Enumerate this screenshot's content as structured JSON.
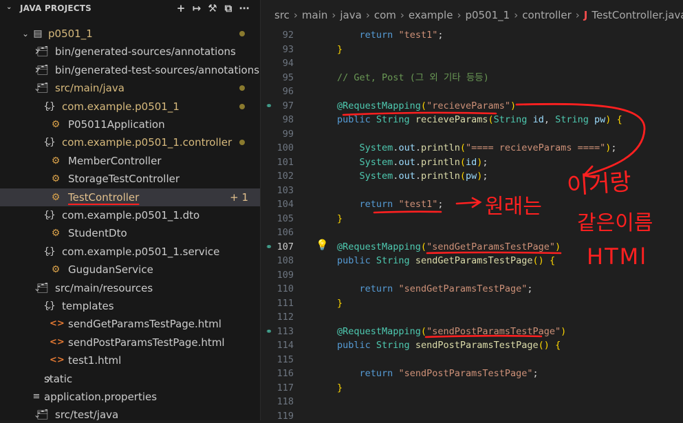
{
  "sidebar": {
    "title": "JAVA PROJECTS",
    "actions": [
      "add-icon",
      "link-icon",
      "tools-icon",
      "collapse-icon",
      "more-icon"
    ],
    "items": [
      {
        "label": "p0501_1",
        "depth": 1,
        "twisty": "open",
        "icon": "project-icon",
        "color": "yellow",
        "dot": true
      },
      {
        "label": "bin/generated-sources/annotations",
        "depth": 2,
        "twisty": "closed",
        "icon": "folder-icon"
      },
      {
        "label": "bin/generated-test-sources/annotations",
        "depth": 2,
        "twisty": "closed",
        "icon": "folder-icon"
      },
      {
        "label": "src/main/java",
        "depth": 2,
        "twisty": "open",
        "icon": "folder-icon",
        "color": "yellow",
        "dot": true
      },
      {
        "label": "com.example.p0501_1",
        "depth": 3,
        "twisty": "open",
        "icon": "package-icon",
        "color": "yellow",
        "dot": true
      },
      {
        "label": "P05011Application",
        "depth": 4,
        "icon": "class-icon"
      },
      {
        "label": "com.example.p0501_1.controller",
        "depth": 3,
        "twisty": "open",
        "icon": "package-icon",
        "color": "yellow",
        "dot": true
      },
      {
        "label": "MemberController",
        "depth": 4,
        "icon": "class-icon"
      },
      {
        "label": "StorageTestController",
        "depth": 4,
        "icon": "class-icon"
      },
      {
        "label": "TestController",
        "depth": 4,
        "icon": "class-icon",
        "color": "orange",
        "selected": true,
        "badge": "1"
      },
      {
        "label": "com.example.p0501_1.dto",
        "depth": 3,
        "twisty": "open",
        "icon": "package-icon"
      },
      {
        "label": "StudentDto",
        "depth": 4,
        "icon": "class-icon"
      },
      {
        "label": "com.example.p0501_1.service",
        "depth": 3,
        "twisty": "open",
        "icon": "package-icon"
      },
      {
        "label": "GugudanService",
        "depth": 4,
        "icon": "class-icon"
      },
      {
        "label": "src/main/resources",
        "depth": 2,
        "twisty": "open",
        "icon": "folder-icon"
      },
      {
        "label": "templates",
        "depth": 3,
        "twisty": "open",
        "icon": "package-icon"
      },
      {
        "label": "sendGetParamsTestPage.html",
        "depth": 4,
        "icon": "html-icon"
      },
      {
        "label": "sendPostParamsTestPage.html",
        "depth": 4,
        "icon": "html-icon"
      },
      {
        "label": "test1.html",
        "depth": 4,
        "icon": "html-icon"
      },
      {
        "label": "static",
        "depth": 3,
        "twisty": "closed"
      },
      {
        "label": "application.properties",
        "depth": 3,
        "icon": "properties-icon"
      },
      {
        "label": "src/test/java",
        "depth": 2,
        "twisty": "open",
        "icon": "folder-icon"
      }
    ]
  },
  "breadcrumb": [
    "src",
    "main",
    "java",
    "com",
    "example",
    "p0501_1",
    "controller",
    "TestController.java"
  ],
  "editor": {
    "lines": [
      {
        "n": "92",
        "text": "        return \"test1\";"
      },
      {
        "n": "93",
        "text": "    }"
      },
      {
        "n": "94",
        "text": ""
      },
      {
        "n": "95",
        "text": "    // Get, Post (그 외 기타 등등)"
      },
      {
        "n": "96",
        "text": ""
      },
      {
        "n": "97",
        "text": "    @RequestMapping(\"recieveParams\")",
        "gutter": "link"
      },
      {
        "n": "98",
        "text": "    public String recieveParams(String id, String pw) {"
      },
      {
        "n": "99",
        "text": ""
      },
      {
        "n": "100",
        "text": "        System.out.println(\"==== recieveParams ====\");"
      },
      {
        "n": "101",
        "text": "        System.out.println(id);"
      },
      {
        "n": "102",
        "text": "        System.out.println(pw);"
      },
      {
        "n": "103",
        "text": ""
      },
      {
        "n": "104",
        "text": "        return \"test1\";"
      },
      {
        "n": "105",
        "text": "    }"
      },
      {
        "n": "106",
        "text": ""
      },
      {
        "n": "107",
        "text": "    @RequestMapping(\"sendGetParamsTestPage\")",
        "gutter": "link",
        "active": true
      },
      {
        "n": "108",
        "text": "    public String sendGetParamsTestPage() {"
      },
      {
        "n": "109",
        "text": ""
      },
      {
        "n": "110",
        "text": "        return \"sendGetParamsTestPage\";"
      },
      {
        "n": "111",
        "text": "    }"
      },
      {
        "n": "112",
        "text": ""
      },
      {
        "n": "113",
        "text": "    @RequestMapping(\"sendPostParamsTestPage\")",
        "gutter": "link"
      },
      {
        "n": "114",
        "text": "    public String sendPostParamsTestPage() {"
      },
      {
        "n": "115",
        "text": ""
      },
      {
        "n": "116",
        "text": "        return \"sendPostParamsTestPage\";"
      },
      {
        "n": "117",
        "text": "    }"
      },
      {
        "n": "118",
        "text": ""
      },
      {
        "n": "119",
        "text": ""
      }
    ],
    "annotation": {
      "arrow_text": "원래는",
      "right_text_1": "이거랑",
      "right_text_2": "같은이름",
      "right_text_3": "HTMl"
    }
  },
  "colors": {
    "accent_yellow": "#d7ba7d",
    "selected_orange": "#e2c08d",
    "ink_red": "#ff2020",
    "java_icon_red": "#f14c4c"
  }
}
